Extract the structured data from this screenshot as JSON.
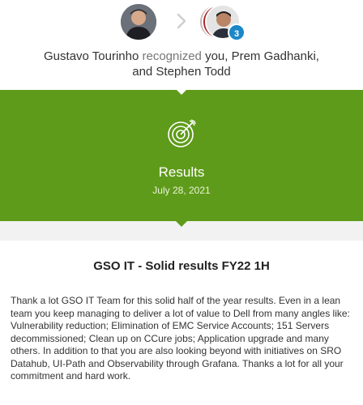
{
  "recognition": {
    "sender": "Gustavo Tourinho",
    "verb": "recognized",
    "recipients_line1": "you, Prem Gadhanki,",
    "recipients_line2": "and Stephen Todd",
    "additional_recipients_count": "3"
  },
  "award": {
    "icon": "target-icon",
    "title": "Results",
    "date": "July 28, 2021"
  },
  "message": {
    "title": "GSO IT - Solid results FY22 1H",
    "body": "Thank a lot GSO IT Team for this solid half of the year results. Even in a lean team you keep managing to deliver a lot of value to Dell from many angles like: Vulnerability reduction; Elimination of EMC Service Accounts; 151 Servers decommissioned; Clean up on CCure jobs; Application upgrade and many others. In addition to that you are also looking beyond with initiatives on SRO Datahub, UI-Path and Observability through Grafana. Thanks a lot for all your commitment and hard work."
  },
  "colors": {
    "banner": "#5f9b1a",
    "badge": "#1a87c8"
  }
}
